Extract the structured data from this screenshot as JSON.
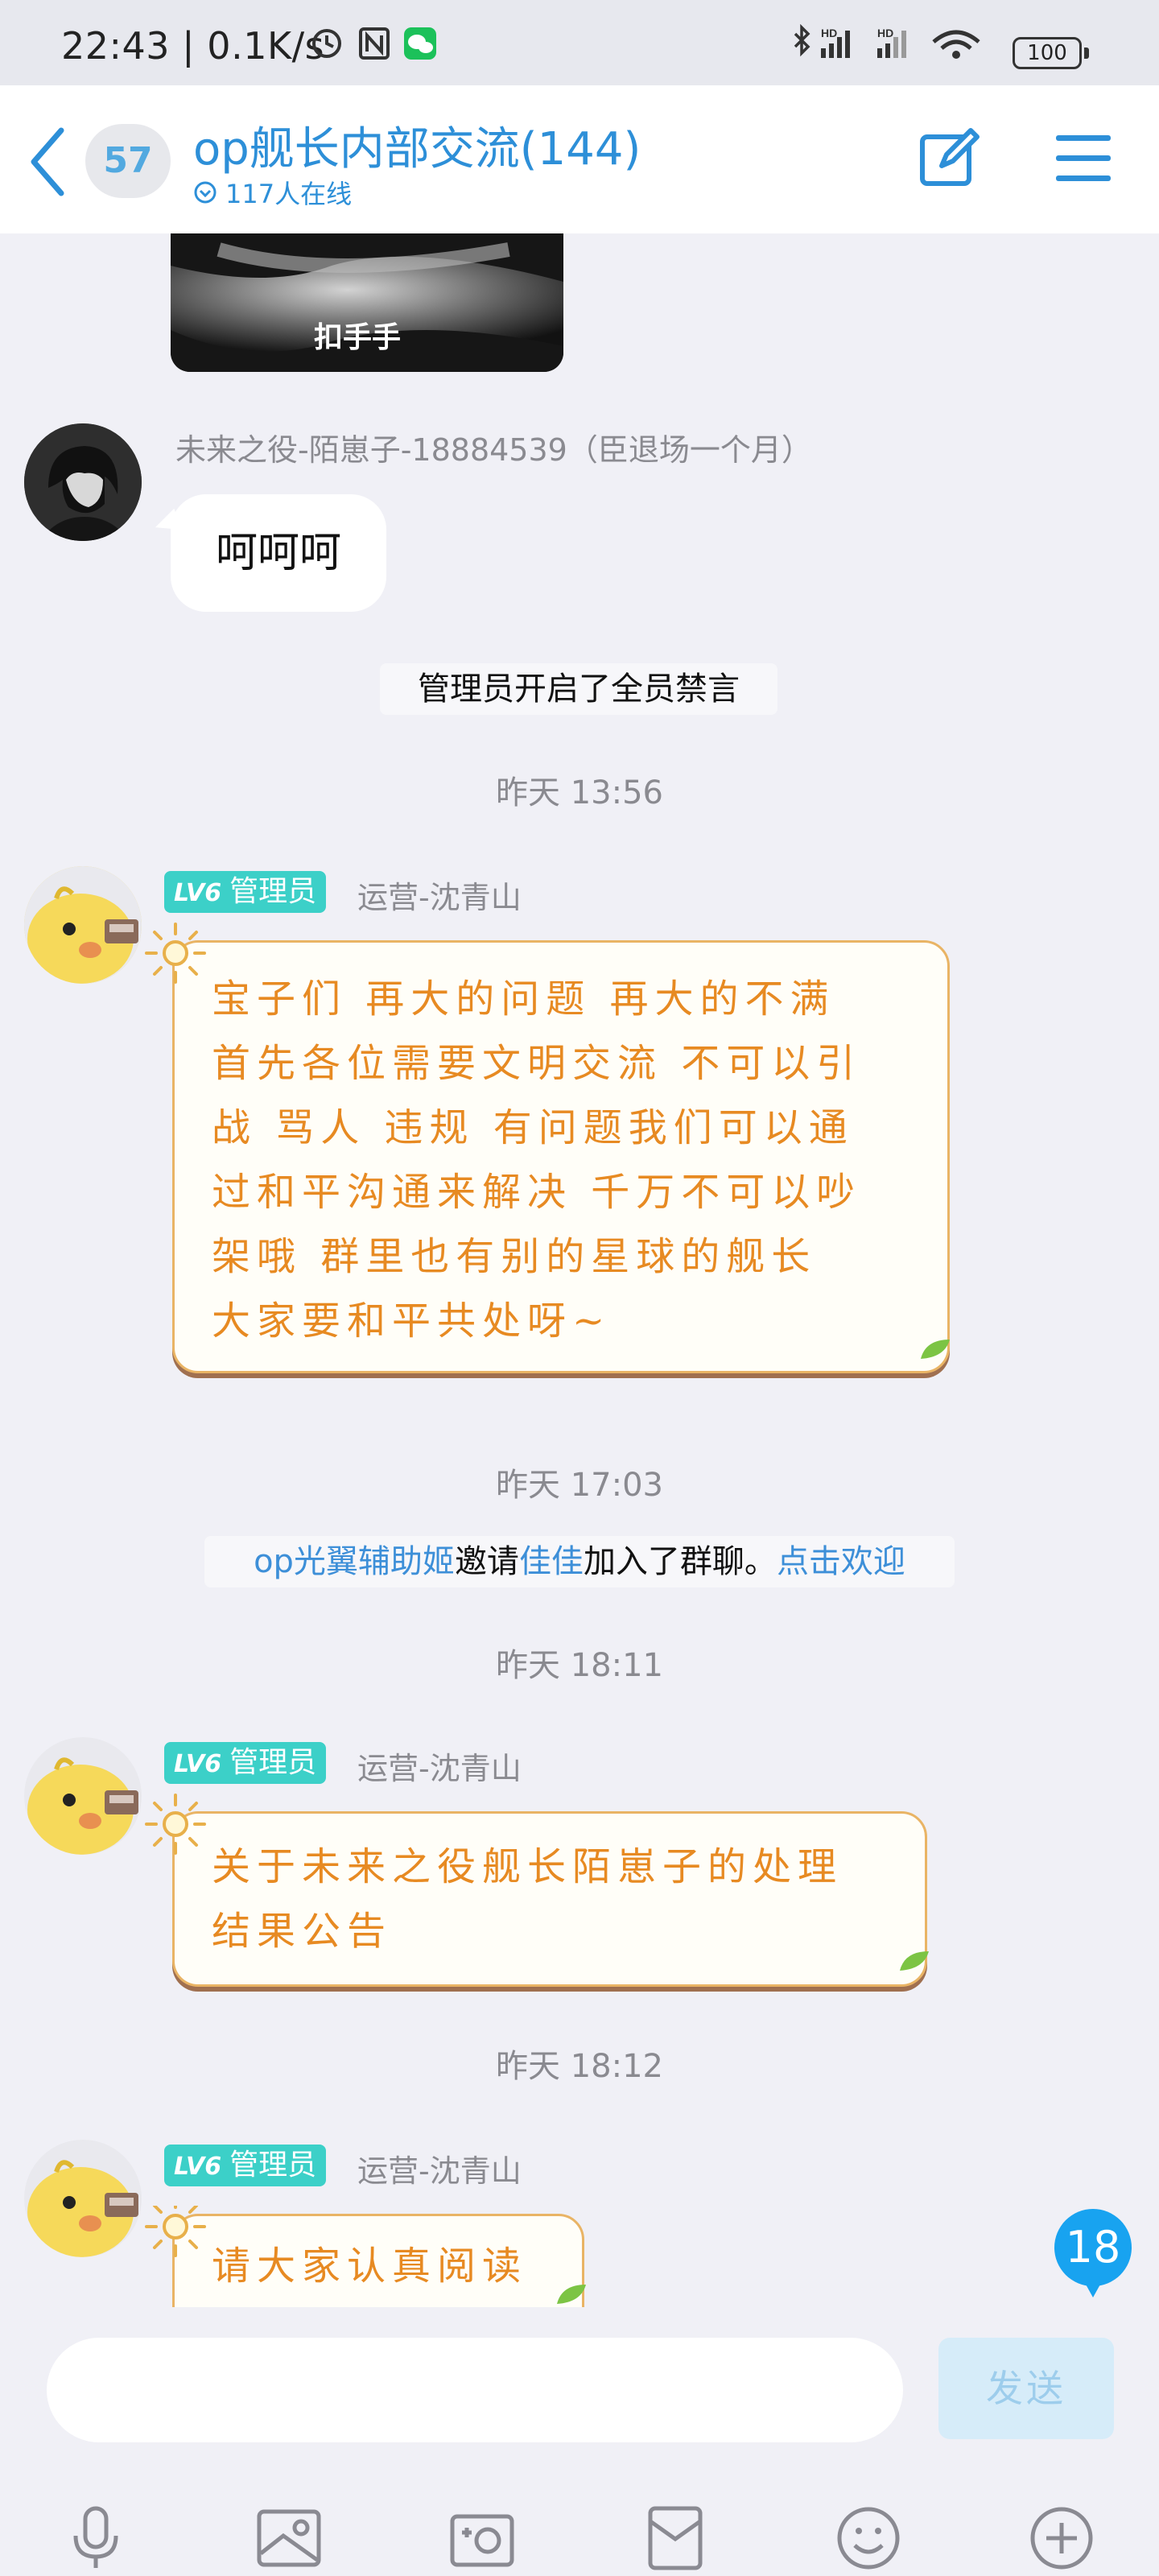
{
  "status_bar": {
    "time": "22:43 | 0.1K/s",
    "battery": "100"
  },
  "header": {
    "unread_count": "57",
    "title": "op舰长内部交流(144)",
    "online_text": "117人在线"
  },
  "messages": [
    {
      "type": "image",
      "caption": "扣手手"
    },
    {
      "type": "text",
      "sender": "未来之役-陌崽子-18884539（臣退场一个月）",
      "text": "呵呵呵"
    },
    {
      "type": "system",
      "text": "管理员开启了全员禁言"
    },
    {
      "type": "timestamp",
      "text": "昨天 13:56"
    },
    {
      "type": "deco",
      "level": "LV6",
      "role": "管理员",
      "sender": "运营-沈青山",
      "lines": [
        "宝子们 再大的问题 再大的不满",
        "首先各位需要文明交流 不可以引",
        "战 骂人 违规 有问题我们可以通",
        "过和平沟通来解决 千万不可以吵",
        "架哦 群里也有别的星球的舰长",
        "大家要和平共处呀~"
      ]
    },
    {
      "type": "timestamp",
      "text": "昨天 17:03"
    },
    {
      "type": "system_invite",
      "inviter": "op光翼辅助姬",
      "verb": "邀请",
      "invitee": "佳佳",
      "suffix": "加入了群聊。",
      "action": "点击欢迎"
    },
    {
      "type": "timestamp",
      "text": "昨天 18:11"
    },
    {
      "type": "deco",
      "level": "LV6",
      "role": "管理员",
      "sender": "运营-沈青山",
      "lines": [
        "关于未来之役舰长陌崽子的处理",
        "结果公告"
      ]
    },
    {
      "type": "timestamp",
      "text": "昨天 18:12"
    },
    {
      "type": "deco",
      "level": "LV6",
      "role": "管理员",
      "sender": "运营-沈青山",
      "lines": [
        "请大家认真阅读"
      ]
    }
  ],
  "new_message_count": "18",
  "input": {
    "placeholder": "",
    "send_label": "发送"
  },
  "toolbar_icons": [
    "microphone-icon",
    "image-icon",
    "camera-icon",
    "red-packet-icon",
    "emoji-icon",
    "plus-icon"
  ],
  "colors": {
    "accent": "#2d8fd8",
    "badge_teal": "#3cd0c8",
    "deco_text": "#e78a22",
    "unread_bubble": "#18a3f0"
  }
}
